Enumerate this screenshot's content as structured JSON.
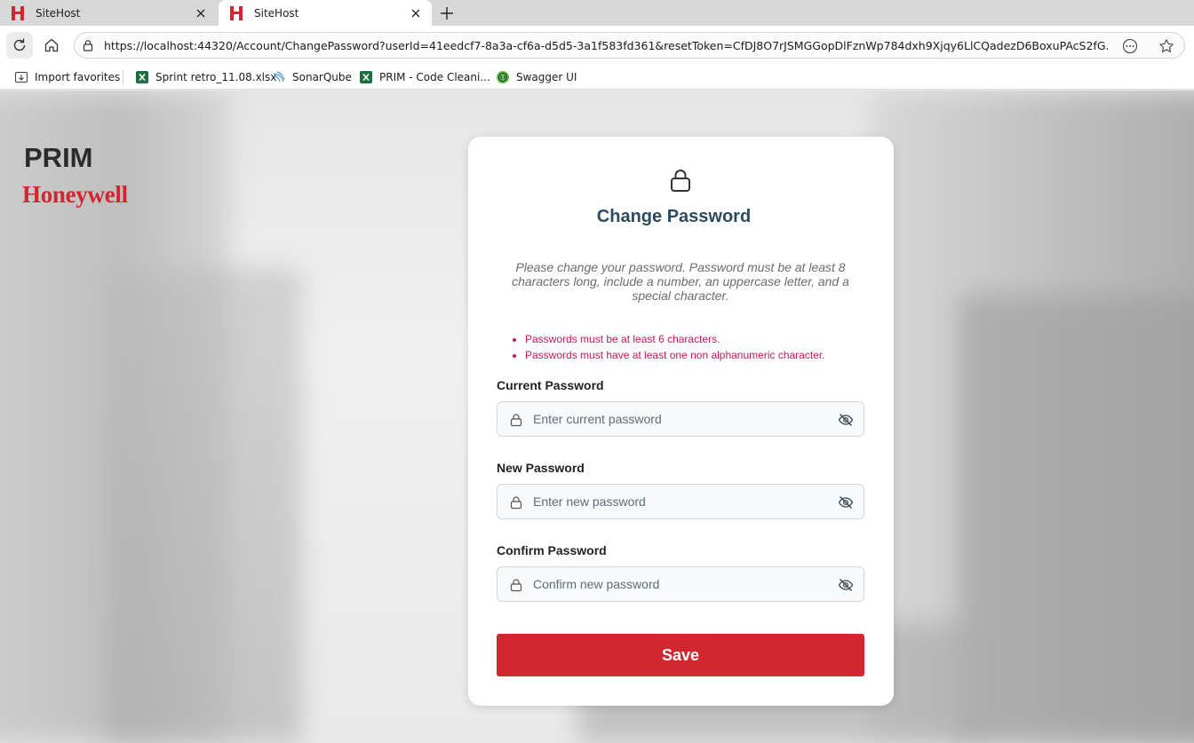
{
  "browser": {
    "tabs": [
      {
        "title": "SiteHost",
        "active": false,
        "icon": "honeywell-h-icon"
      },
      {
        "title": "SiteHost",
        "active": true,
        "icon": "honeywell-h-icon"
      }
    ],
    "url": "https://localhost:44320/Account/ChangePassword?userId=41eedcf7-8a3a-cf6a-d5d5-3a1f583fd361&resetToken=CfDJ8O7rJSMGGopDlFznWp784dxh9Xjqy6LlCQadezD6BoxuPAcS2fG...",
    "favorites": [
      {
        "label": "Import favorites",
        "icon": "import-icon"
      },
      {
        "label": "Sprint retro_11.08.xlsx",
        "icon": "excel-icon"
      },
      {
        "label": "SonarQube",
        "icon": "sonarqube-icon"
      },
      {
        "label": "PRIM - Code Cleani...",
        "icon": "excel-icon"
      },
      {
        "label": "Swagger UI",
        "icon": "swagger-icon"
      }
    ],
    "colors": {
      "tab_icon": "#d22630",
      "excel": "#1d6f42",
      "swagger": "#6cc24a"
    }
  },
  "brand": {
    "product": "PRIM",
    "company": "Honeywell"
  },
  "form": {
    "title": "Change Password",
    "description": "Please change your password. Password must be at least 8 characters long, include a number, an uppercase letter, and a special character.",
    "errors": [
      "Passwords must be at least 6 characters.",
      "Passwords must have at least one non alphanumeric character."
    ],
    "fields": {
      "current": {
        "label": "Current Password",
        "placeholder": "Enter current password",
        "value": ""
      },
      "new": {
        "label": "New Password",
        "placeholder": "Enter new password",
        "value": ""
      },
      "confirm": {
        "label": "Confirm Password",
        "placeholder": "Confirm new password",
        "value": ""
      }
    },
    "save_label": "Save"
  },
  "theme": {
    "accent": "#d22630",
    "heading": "#2d4a5e",
    "error": "#c2185b"
  }
}
